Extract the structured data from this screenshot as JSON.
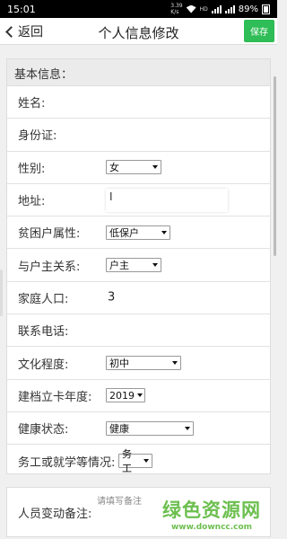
{
  "status_bar": {
    "time": "15:01",
    "speed": "3.39",
    "speed_unit": "K/s",
    "network": "HD",
    "battery": "89%"
  },
  "nav": {
    "back_label": "返回",
    "title": "个人信息修改",
    "save_label": "保存"
  },
  "form": {
    "section_title": "基本信息：",
    "name_label": "姓名:",
    "id_label": "身份证:",
    "gender": {
      "label": "性别:",
      "value": "女"
    },
    "address_label": "地址:",
    "address_value": "I",
    "poverty_type": {
      "label": "贫困户属性:",
      "value": "低保户"
    },
    "relation": {
      "label": "与户主关系:",
      "value": "户主"
    },
    "household_size": {
      "label": "家庭人口:",
      "value": "3"
    },
    "phone_label": "联系电话:",
    "education": {
      "label": "文化程度:",
      "value": "初中"
    },
    "registration_year": {
      "label": "建档立卡年度:",
      "value": "2019"
    },
    "health": {
      "label": "健康状态:",
      "value": "健康"
    },
    "work_status": {
      "label": "务工或就学等情况:",
      "value": "务工"
    }
  },
  "remarks": {
    "label": "人员变动备注:",
    "placeholder": "请填写备注"
  },
  "watermark": {
    "title": "绿色资源网",
    "url": "www.downcc.com"
  },
  "colors": {
    "save_button": "#2ebd56",
    "watermark": "#6cbf4f"
  }
}
